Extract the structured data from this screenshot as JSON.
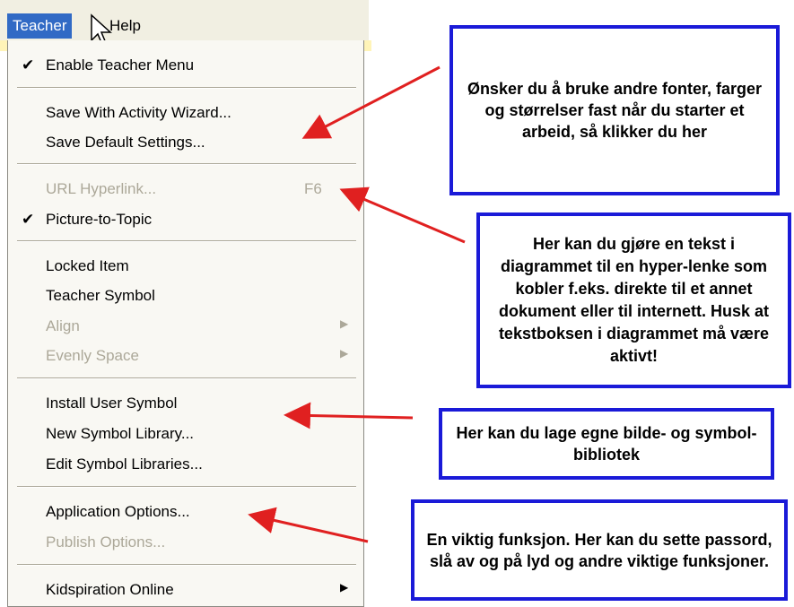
{
  "menubar": {
    "teacher_label": "Teacher",
    "help_label": "Help"
  },
  "menu": {
    "enable_teacher_menu": "Enable Teacher Menu",
    "save_with_activity_wizard": "Save With Activity Wizard...",
    "save_default_settings": "Save Default Settings...",
    "url_hyperlink": "URL Hyperlink...",
    "url_hyperlink_shortcut": "F6",
    "picture_to_topic": "Picture-to-Topic",
    "locked_item": "Locked Item",
    "teacher_symbol": "Teacher Symbol",
    "align": "Align",
    "evenly_space": "Evenly Space",
    "install_user_symbol": "Install User Symbol",
    "new_symbol_library": "New Symbol Library...",
    "edit_symbol_libraries": "Edit Symbol Libraries...",
    "application_options": "Application Options...",
    "publish_options": "Publish Options...",
    "kidspiration_online": "Kidspiration Online"
  },
  "callouts": {
    "default_settings": "Ønsker du å bruke andre fonter, farger og størrelser fast når du starter et arbeid, så klikker du her",
    "hyperlink": "Her kan du gjøre en tekst i diagrammet til en hyper-lenke som kobler f.eks. direkte til et annet dokument eller til internett. Husk at tekstboksen i diagrammet må være aktivt!",
    "symbol_library": "Her kan du lage egne bilde- og symbol-bibliotek",
    "app_options": "En viktig funksjon. Her kan du sette passord, slå av og på lyd og andre viktige funksjoner."
  },
  "colors": {
    "highlight": "#316ac5",
    "callout_border": "#1a1ad8",
    "arrow": "#e02020"
  }
}
